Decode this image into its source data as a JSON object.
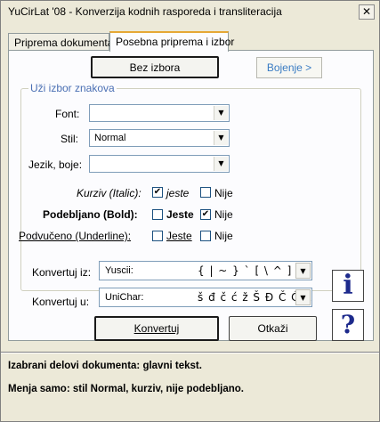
{
  "window": {
    "title": "YuCirLat '08 - Konverzija kodnih rasporeda i transliteracija",
    "close_glyph": "✕"
  },
  "tabs": [
    {
      "label": "Priprema dokumenta"
    },
    {
      "label": "Posebna priprema i izbor"
    }
  ],
  "panel": {
    "bez_izbora_label": "Bez izbora",
    "bojenje_label": "Bojenje >",
    "group_title": "Uži izbor znakova",
    "font_label": "Font:",
    "font_value": "",
    "stil_label": "Stil:",
    "stil_value": "Normal",
    "jezik_label": "Jezik, boje:",
    "jezik_value": "",
    "italic_label": "Kurziv (Italic):",
    "italic_yes": "jeste",
    "italic_no": "Nije",
    "italic_yes_checked": true,
    "italic_no_checked": false,
    "bold_label": "Podebljano (Bold):",
    "bold_yes": "Jeste",
    "bold_no": "Nije",
    "bold_yes_checked": false,
    "bold_no_checked": true,
    "underline_label": "Podvučeno (Underline):",
    "underline_yes": "Jeste",
    "underline_no": "Nije",
    "underline_yes_checked": false,
    "underline_no_checked": false,
    "check_glyph": "✔",
    "arrow_glyph": "▼"
  },
  "convert": {
    "from_label": "Konvertuj iz:",
    "from_name": "Yuscii:",
    "from_chars": "{ | ~ } ` [ \\ ^ ] @",
    "to_label": "Konvertuj u:",
    "to_name": "UniChar:",
    "to_chars": "š đ č ć ž Š Đ Č Ć Ž",
    "konvertuj_label": "Konvertuj",
    "otkazi_label": "Otkaži",
    "info_glyph": "i",
    "help_glyph": "?"
  },
  "status": {
    "line1": "Izabrani delovi dokumenta: glavni tekst.",
    "line2": "Menja samo: stil Normal, kurziv, nije podebljano."
  },
  "colors": {
    "group_title": "#4a6fb3",
    "icon_blue": "#1d2a8c",
    "tab_highlight": "#e6a835"
  }
}
